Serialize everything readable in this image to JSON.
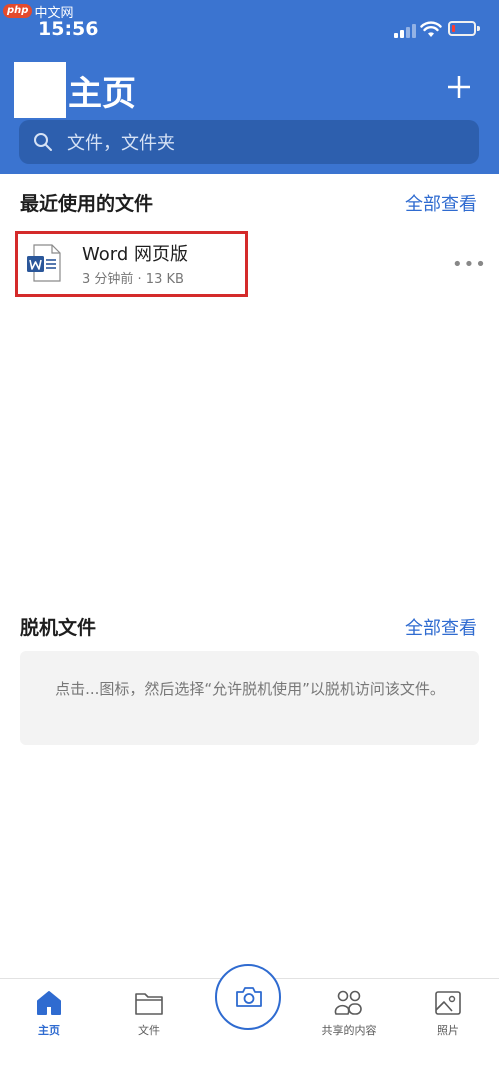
{
  "watermark": {
    "badge": "php",
    "text": "中文网"
  },
  "status": {
    "time": "15:56"
  },
  "header": {
    "title": "主页",
    "search_placeholder": "文件，文件夹"
  },
  "recent": {
    "title": "最近使用的文件",
    "view_all": "全部查看",
    "files": [
      {
        "name": "Word 网页版",
        "meta": "3 分钟前 · 13 KB",
        "icon": "word-doc-icon"
      }
    ]
  },
  "offline": {
    "title": "脱机文件",
    "view_all": "全部查看",
    "hint": "点击...图标，然后选择“允许脱机使用”以脱机访问该文件。"
  },
  "tabs": [
    {
      "label": "主页",
      "icon": "home-icon",
      "active": true
    },
    {
      "label": "文件",
      "icon": "folder-icon",
      "active": false
    },
    {
      "label": "",
      "icon": "camera-icon",
      "active": false
    },
    {
      "label": "共享的内容",
      "icon": "people-icon",
      "active": false
    },
    {
      "label": "照片",
      "icon": "photo-icon",
      "active": false
    }
  ],
  "colors": {
    "accent": "#3b74d0",
    "link": "#2f6bd0",
    "highlight": "#d42a2a"
  }
}
